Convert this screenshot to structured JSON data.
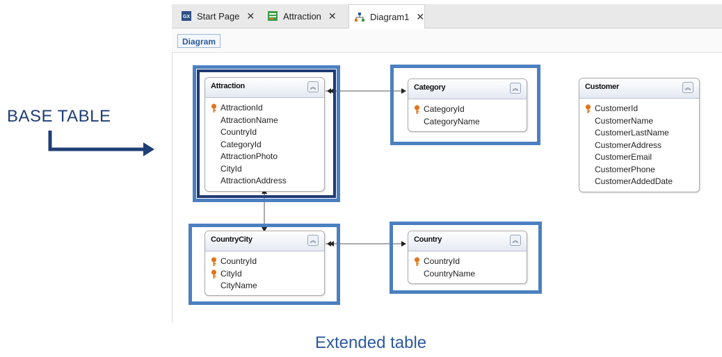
{
  "tabs": [
    {
      "label": "Start Page",
      "icon": "genexus-icon"
    },
    {
      "label": "Attraction",
      "icon": "transaction-icon"
    },
    {
      "label": "Diagram1",
      "icon": "diagram-icon",
      "active": true
    }
  ],
  "toolbar": {
    "diagram_label": "Diagram"
  },
  "entities": {
    "attraction": {
      "title": "Attraction",
      "attrs": [
        "AttractionId",
        "AttractionName",
        "CountryId",
        "CategoryId",
        "AttractionPhoto",
        "CityId",
        "AttractionAddress"
      ]
    },
    "category": {
      "title": "Category",
      "attrs": [
        "CategoryId",
        "CategoryName"
      ]
    },
    "customer": {
      "title": "Customer",
      "attrs": [
        "CustomerId",
        "CustomerName",
        "CustomerLastName",
        "CustomerAddress",
        "CustomerEmail",
        "CustomerPhone",
        "CustomerAddedDate"
      ]
    },
    "countrycity": {
      "title": "CountryCity",
      "attrs": [
        "CountryId",
        "CityId",
        "CityName"
      ]
    },
    "country": {
      "title": "Country",
      "attrs": [
        "CountryId",
        "CountryName"
      ]
    }
  },
  "annotations": {
    "base_table": "BASE TABLE",
    "extended_table": "Extended table"
  },
  "colors": {
    "highlight": "#4c7fc0",
    "base_highlight": "#1f3a73",
    "label": "#1f3e75",
    "key": "#e2761b"
  }
}
